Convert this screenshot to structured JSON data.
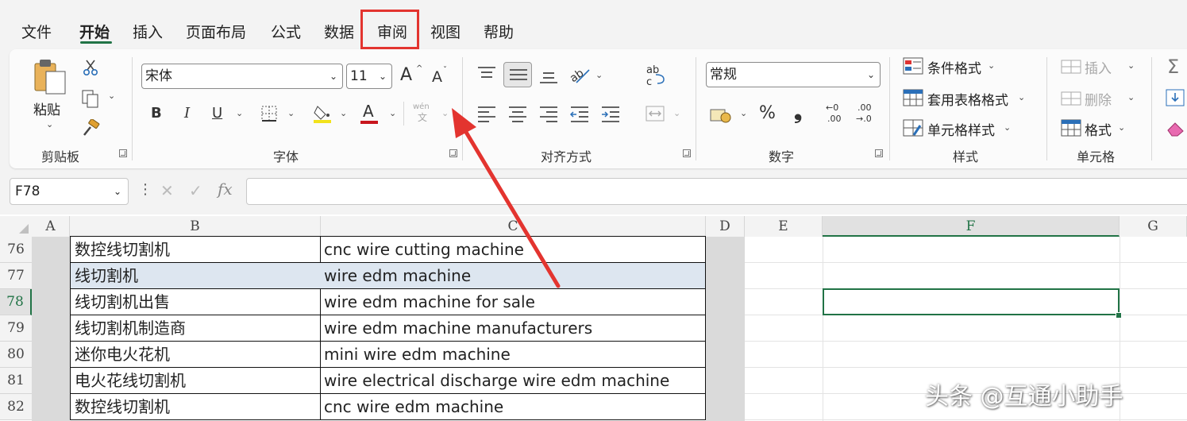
{
  "tabs": [
    {
      "label": "文件"
    },
    {
      "label": "开始"
    },
    {
      "label": "插入"
    },
    {
      "label": "页面布局"
    },
    {
      "label": "公式"
    },
    {
      "label": "数据"
    },
    {
      "label": "审阅"
    },
    {
      "label": "视图"
    },
    {
      "label": "帮助"
    }
  ],
  "active_tab": "开始",
  "highlighted_tab": "审阅",
  "ribbon": {
    "clipboard": {
      "paste_label": "粘贴",
      "group_label": "剪贴板"
    },
    "font": {
      "font_name": "宋体",
      "font_size": "11",
      "group_label": "字体",
      "bold": "B",
      "italic": "I",
      "underline": "U",
      "grow": "A",
      "shrink": "A",
      "phonetic_top": "wén",
      "phonetic_bottom": "文"
    },
    "alignment": {
      "group_label": "对齐方式"
    },
    "number": {
      "format": "常规",
      "group_label": "数字",
      "percent": "%",
      "comma": "❟",
      "inc_decimal_top": "←0",
      "inc_decimal_bottom": ".00",
      "dec_decimal_top": ".00",
      "dec_decimal_bottom": "→.0"
    },
    "styles": {
      "conditional": "条件格式",
      "table_format": "套用表格格式",
      "cell_styles": "单元格样式",
      "group_label": "样式"
    },
    "cells": {
      "insert": "插入",
      "delete": "删除",
      "format": "格式",
      "group_label": "单元格"
    }
  },
  "formula_bar": {
    "name_box": "F78",
    "fx": "fx",
    "content": ""
  },
  "columns": [
    {
      "label": "A"
    },
    {
      "label": "B"
    },
    {
      "label": "C"
    },
    {
      "label": "D"
    },
    {
      "label": "E"
    },
    {
      "label": "F"
    },
    {
      "label": "G"
    }
  ],
  "selected_column": "F",
  "rows": [
    {
      "num": "76",
      "b": "数控线切割机",
      "c": "cnc wire cutting machine"
    },
    {
      "num": "77",
      "b": "线切割机",
      "c": "wire edm machine"
    },
    {
      "num": "78",
      "b": "线切割机出售",
      "c": "wire edm machine for sale"
    },
    {
      "num": "79",
      "b": "线切割机制造商",
      "c": "wire edm machine manufacturers"
    },
    {
      "num": "80",
      "b": "迷你电火花机",
      "c": "mini wire edm machine"
    },
    {
      "num": "81",
      "b": "电火花线切割机",
      "c": "wire electrical discharge wire edm machine"
    },
    {
      "num": "82",
      "b": "数控线切割机",
      "c": "cnc wire edm machine"
    }
  ],
  "active_cell": "F78",
  "watermark": "头条 @互通小助手",
  "colors": {
    "accent": "#217346",
    "annotation": "#e3342f",
    "row_highlight": "#dde6f0"
  }
}
